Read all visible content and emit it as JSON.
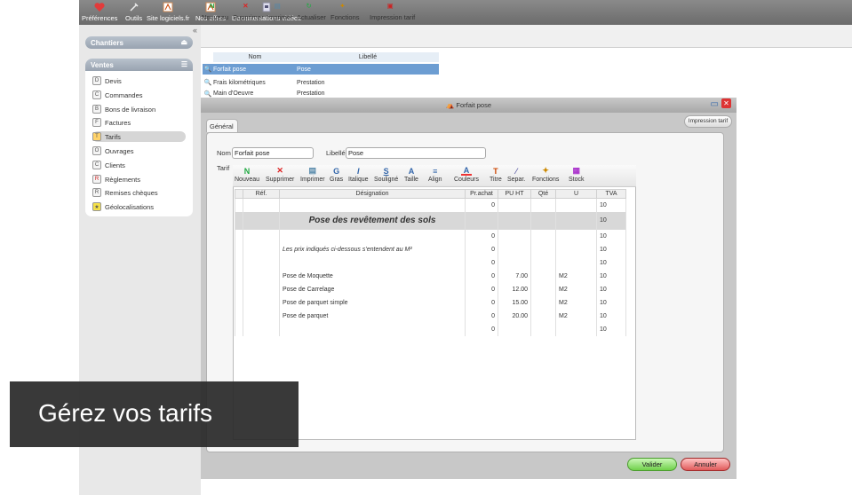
{
  "topbar": {
    "items": [
      {
        "label": "Préférences",
        "icon": "heart-icon",
        "color": "#e23b3b"
      },
      {
        "label": "Outils",
        "icon": "tools-icon"
      },
      {
        "label": "Site logiciels.fr",
        "icon": "site-icon"
      },
      {
        "label": "Nos offres",
        "icon": "offers-icon"
      },
      {
        "label": "Documentations vidéos",
        "icon": "video-docs-icon"
      }
    ]
  },
  "sidebar": {
    "chantiers_label": "Chantiers",
    "ventes_label": "Ventes",
    "items": [
      {
        "label": "Devis",
        "icon": "D"
      },
      {
        "label": "Commandes",
        "icon": "C"
      },
      {
        "label": "Bons de livraison",
        "icon": "BL"
      },
      {
        "label": "Factures",
        "icon": "F"
      },
      {
        "label": "Tarifs",
        "icon": "T"
      },
      {
        "label": "Ouvrages",
        "icon": "O"
      },
      {
        "label": "Clients",
        "icon": "Cl"
      },
      {
        "label": "Règlements",
        "icon": "R"
      },
      {
        "label": "Remises chèques",
        "icon": "RC"
      },
      {
        "label": "Géolocalisations",
        "icon": "G"
      }
    ]
  },
  "main_toolbar": {
    "buttons": [
      "Nouveau",
      "Supprimer",
      "Imprimer",
      "Actualiser",
      "Fonctions",
      "Impression tarif"
    ]
  },
  "list": {
    "headers": [
      "Nom",
      "Libellé"
    ],
    "rows": [
      {
        "nom": "Forfait pose",
        "libelle": "Pose"
      },
      {
        "nom": "Frais kilométriques",
        "libelle": "Prestation"
      },
      {
        "nom": "Main d'Oeuvre",
        "libelle": "Prestation"
      }
    ]
  },
  "modal": {
    "title": "Forfait pose",
    "tab": "Général",
    "impression_tarif": "Impression tarif",
    "nom_label": "Nom",
    "nom_value": "Forfait pose",
    "libelle_label": "Libellé",
    "libelle_value": "Pose",
    "tarif_label": "Tarif",
    "valider": "Valider",
    "annuler": "Annuler"
  },
  "tarif_toolbar": {
    "buttons": [
      "Nouveau",
      "Supprimer",
      "Imprimer",
      "Gras",
      "Italique",
      "Souligné",
      "Taille",
      "Align",
      "Couleurs",
      "Titre",
      "Separ.",
      "Fonctions",
      "Stock"
    ]
  },
  "grid": {
    "headers": [
      "Réf.",
      "Désignation",
      "Pr.achat",
      "PU HT",
      "Qté",
      "U",
      "TVA"
    ],
    "rows": [
      {
        "ref": "",
        "designation": "",
        "prachat": "0",
        "puht": "",
        "qte": "",
        "u": "",
        "tva": "10",
        "style": ""
      },
      {
        "ref": "",
        "designation": "Pose des revêtement des sols",
        "prachat": "",
        "puht": "",
        "qte": "",
        "u": "",
        "tva": "10",
        "style": "title"
      },
      {
        "ref": "",
        "designation": "",
        "prachat": "0",
        "puht": "",
        "qte": "",
        "u": "",
        "tva": "10",
        "style": ""
      },
      {
        "ref": "",
        "designation": "Les prix indiqués ci-dessous s'entendent au M²",
        "prachat": "0",
        "puht": "",
        "qte": "",
        "u": "",
        "tva": "10",
        "style": "italic"
      },
      {
        "ref": "",
        "designation": "",
        "prachat": "0",
        "puht": "",
        "qte": "",
        "u": "",
        "tva": "10",
        "style": ""
      },
      {
        "ref": "",
        "designation": "Pose de Moquette",
        "prachat": "0",
        "puht": "7.00",
        "qte": "",
        "u": "M2",
        "tva": "10",
        "style": ""
      },
      {
        "ref": "",
        "designation": "Pose de Carrelage",
        "prachat": "0",
        "puht": "12.00",
        "qte": "",
        "u": "M2",
        "tva": "10",
        "style": ""
      },
      {
        "ref": "",
        "designation": "Pose de parquet simple",
        "prachat": "0",
        "puht": "15.00",
        "qte": "",
        "u": "M2",
        "tva": "10",
        "style": ""
      },
      {
        "ref": "",
        "designation": "Pose de parquet",
        "prachat": "0",
        "puht": "20.00",
        "qte": "",
        "u": "M2",
        "tva": "10",
        "style": ""
      },
      {
        "ref": "",
        "designation": "",
        "prachat": "0",
        "puht": "",
        "qte": "",
        "u": "",
        "tva": "10",
        "style": ""
      }
    ]
  },
  "caption": "Gérez vos tarifs"
}
